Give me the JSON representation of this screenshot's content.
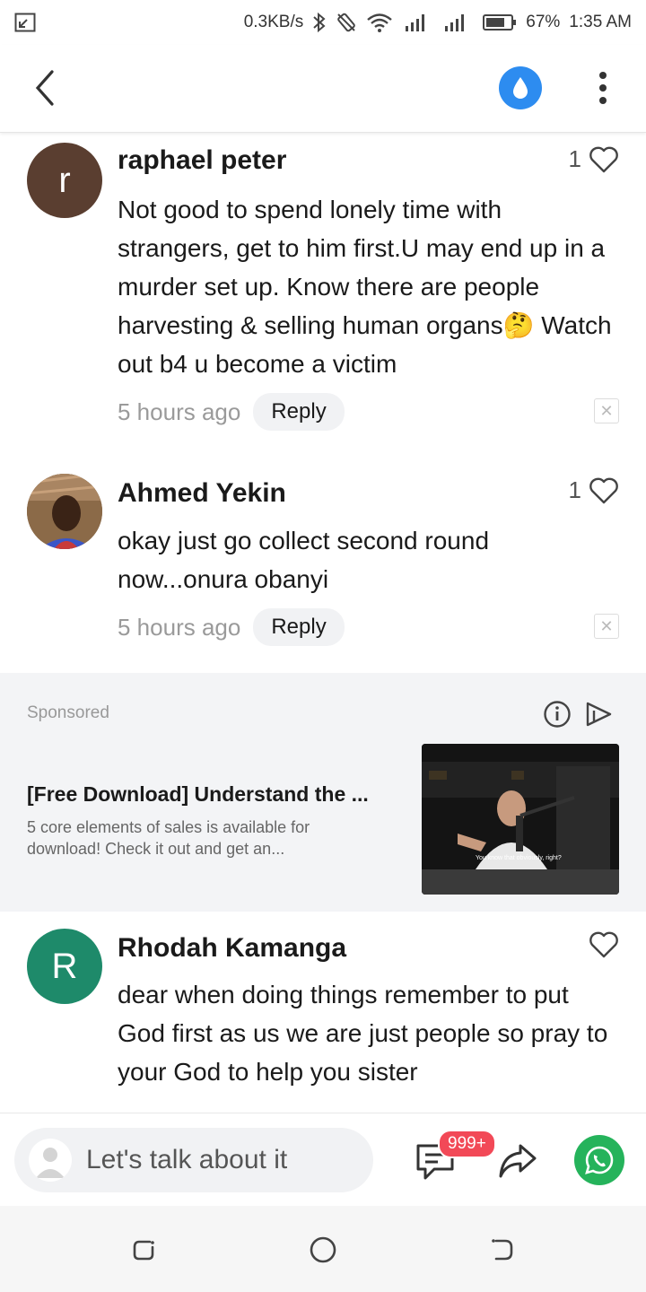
{
  "status_bar": {
    "speed": "0.3KB/s",
    "battery": "67%",
    "time": "1:35 AM"
  },
  "comments": [
    {
      "author": "raphael peter",
      "avatar_letter": "r",
      "avatar_color": "#5a3e30",
      "likes": "1",
      "text": "Not good to spend lonely time with strangers, get to him first.U may end up in a murder set up. Know there are people harvesting & selling human organs🤔 Watch out b4 u become a victim",
      "time": "5 hours ago",
      "reply_label": "Reply"
    },
    {
      "author": "Ahmed Yekin",
      "likes": "1",
      "text": "okay just go collect second round now...onura obanyi",
      "time": "5 hours ago",
      "reply_label": "Reply"
    },
    {
      "author": "Rhodah Kamanga",
      "avatar_letter": "R",
      "avatar_color": "#1e8a6a",
      "text": "dear when doing things remember to put God first as us we are just people so pray to your God to help you sister"
    }
  ],
  "sponsored": {
    "label": "Sponsored",
    "title": "[Free Download] Understand the ...",
    "description": "5 core elements of sales is available for download!   Check it out and get an...",
    "caption": "You know that obviously, right?"
  },
  "bottom_bar": {
    "input_placeholder": "Let's talk about it",
    "badge": "999+"
  },
  "colors": {
    "accent_blue": "#2d8cf0",
    "badge_red": "#f24957",
    "whatsapp_green": "#25b35b"
  }
}
